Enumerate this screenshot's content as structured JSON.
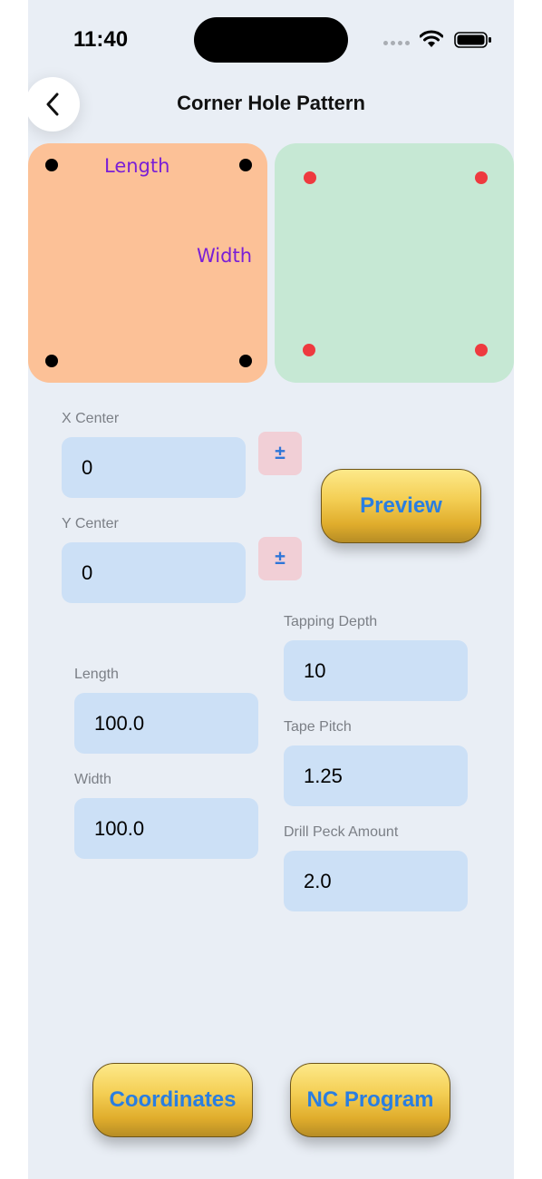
{
  "status_bar": {
    "time": "11:40"
  },
  "header": {
    "title": "Corner Hole Pattern"
  },
  "diagram": {
    "length_label": "Length",
    "width_label": "Width"
  },
  "fields": {
    "x_center": {
      "label": "X Center",
      "value": "0"
    },
    "y_center": {
      "label": "Y Center",
      "value": "0"
    },
    "length": {
      "label": "Length",
      "value": "100.0"
    },
    "width": {
      "label": "Width",
      "value": "100.0"
    },
    "tapping_depth": {
      "label": "Tapping Depth",
      "value": "10"
    },
    "tape_pitch": {
      "label": "Tape Pitch",
      "value": "1.25"
    },
    "drill_peck_amount": {
      "label": "Drill Peck Amount",
      "value": "2.0"
    }
  },
  "buttons": {
    "toggle_sign": "±",
    "preview": "Preview",
    "coordinates": "Coordinates",
    "nc_program": "NC Program"
  },
  "colors": {
    "background": "#e9eef5",
    "diagram_left": "#fcc197",
    "diagram_right": "#c6e8d4",
    "label_purple": "#7a1fd6",
    "input_bg": "#cce0f6",
    "button_text": "#2a7ee0",
    "hole_red": "#ee3a3f"
  }
}
